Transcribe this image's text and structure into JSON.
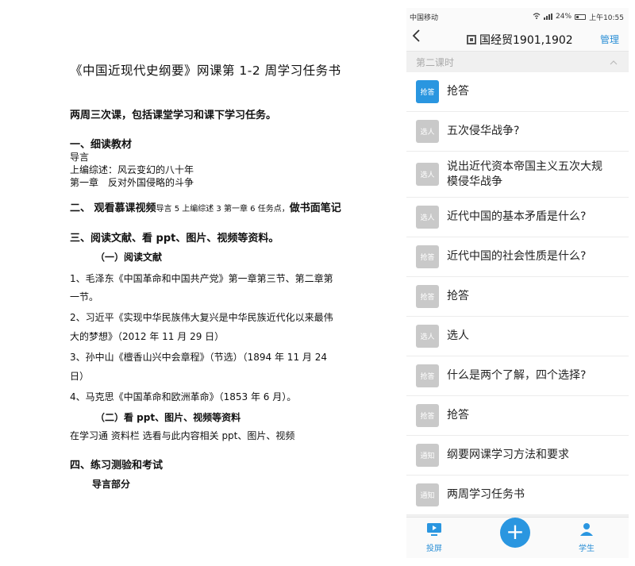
{
  "doc": {
    "title": "《中国近现代史纲要》网课第 1-2 周学习任务书",
    "intro": "两周三次课，包括课堂学习和课下学习任务。",
    "s1": "一、细读教材",
    "s1_l1": "导言",
    "s1_l2": "上编综述：风云变幻的八十年",
    "s1_l3": "第一章　反对外国侵略的斗争",
    "s2_a": "二、 观看慕课视频",
    "s2_b": "导言 5 上编综述 3 第一章 6 任务点，",
    "s2_c": "做书面笔记",
    "s3": "三、阅读文献、看 ppt、图片、视频等资料。",
    "s3_1": "（一）阅读文献",
    "r1a": "1、毛泽东《中国革命和中国共产党》第一章第三节、第二章第",
    "r1b": "一节。",
    "r2a": "2、习近平《实现中华民族伟大复兴是中华民族近代化以来最伟",
    "r2b": "大的梦想》（2012 年 11 月 29 日）",
    "r3a": "3、孙中山《檀香山兴中会章程》（节选）（1894 年 11 月 24",
    "r3b": "日）",
    "r4": "4、马克思《中国革命和欧洲革命》（1853 年 6 月）。",
    "s3_2": "（二）看 ppt、图片、视频等资料",
    "s3_2_l1": "在学习通 资料栏 选看与此内容相关 ppt、图片、视频",
    "s4": "四、练习测验和考试",
    "s4_l1": "导言部分"
  },
  "phone": {
    "carrier": "中国移动",
    "battery": "24%",
    "time": "上午10:55",
    "back_icon": "chevron-left-icon",
    "title": "国经贸1901,1902",
    "manage": "管理",
    "section": "第二课时",
    "items": [
      {
        "badge": "抢答",
        "label": "抢答",
        "active": true
      },
      {
        "badge": "选人",
        "label": "五次侵华战争?"
      },
      {
        "badge": "选人",
        "label": "说出近代资本帝国主义五次大规模侵华战争"
      },
      {
        "badge": "选人",
        "label": "近代中国的基本矛盾是什么?"
      },
      {
        "badge": "抢答",
        "label": "近代中国的社会性质是什么?"
      },
      {
        "badge": "抢答",
        "label": "抢答"
      },
      {
        "badge": "选人",
        "label": "选人"
      },
      {
        "badge": "抢答",
        "label": "什么是两个了解，四个选择?"
      },
      {
        "badge": "抢答",
        "label": "抢答"
      },
      {
        "badge": "通知",
        "label": "纲要网课学习方法和要求"
      },
      {
        "badge": "通知",
        "label": "两周学习任务书"
      }
    ],
    "tabs": {
      "left": "投屏",
      "right": "学生"
    },
    "accent": "#2a96e0"
  }
}
